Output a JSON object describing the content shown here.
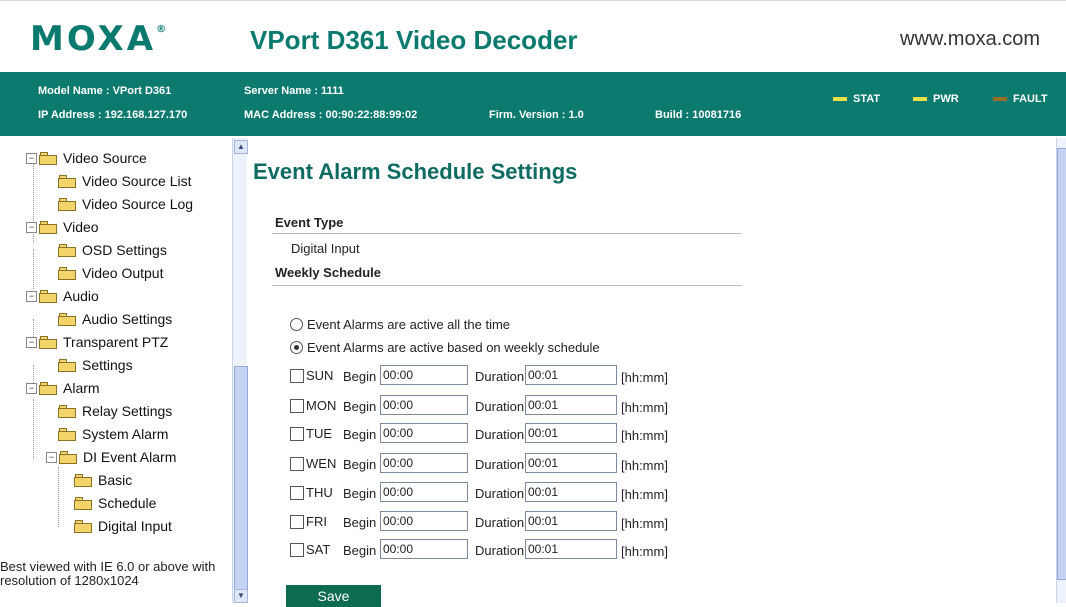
{
  "header": {
    "logo_text": "MOXA",
    "logo_mark": "®",
    "product_title": "VPort D361 Video Decoder",
    "site_url": "www.moxa.com"
  },
  "infobar": {
    "model_name": "Model Name : VPort D361",
    "server_name": "Server Name : 1111",
    "ip_address": "IP Address : 192.168.127.170",
    "mac_address": "MAC Address : 00:90:22:88:99:02",
    "firmware": "Firm. Version : 1.0",
    "build": "Build : 10081716",
    "leds": [
      {
        "label": "STAT",
        "color": "#e8e24a"
      },
      {
        "label": "PWR",
        "color": "#e8e24a"
      },
      {
        "label": "FAULT",
        "color": "#9a6a28"
      }
    ],
    "background": "#0d7a70"
  },
  "sidebar": {
    "items": [
      {
        "label": "Video Source",
        "level": 0,
        "expander": "−"
      },
      {
        "label": "Video Source List",
        "level": 1
      },
      {
        "label": "Video Source Log",
        "level": 1
      },
      {
        "label": "Video",
        "level": 0,
        "expander": "−"
      },
      {
        "label": "OSD Settings",
        "level": 1
      },
      {
        "label": "Video Output",
        "level": 1
      },
      {
        "label": "Audio",
        "level": 0,
        "expander": "−"
      },
      {
        "label": "Audio Settings",
        "level": 1
      },
      {
        "label": "Transparent PTZ",
        "level": 0,
        "expander": "−"
      },
      {
        "label": "Settings",
        "level": 1
      },
      {
        "label": "Alarm",
        "level": 0,
        "expander": "−"
      },
      {
        "label": "Relay Settings",
        "level": 1
      },
      {
        "label": "System Alarm",
        "level": 1
      },
      {
        "label": "DI Event Alarm",
        "level": 1,
        "expander": "−"
      },
      {
        "label": "Basic",
        "level": 2
      },
      {
        "label": "Schedule",
        "level": 2
      },
      {
        "label": "Digital Input",
        "level": 2
      }
    ],
    "best_viewed": "Best viewed with IE 6.0 or above with resolution of 1280x1024"
  },
  "main": {
    "title": "Event Alarm Schedule Settings",
    "event_type_label": "Event Type",
    "event_type_value": "Digital Input",
    "weekly_schedule_label": "Weekly Schedule",
    "radio_always": "Event Alarms are active all the time",
    "radio_weekly": "Event Alarms are active based on weekly schedule",
    "radio_selected": "weekly",
    "begin_label": "Begin",
    "duration_label": "Duration",
    "unit_label": "[hh:mm]",
    "schedule": [
      {
        "day": "SUN",
        "begin": "00:00",
        "duration": "00:01",
        "checked": false
      },
      {
        "day": "MON",
        "begin": "00:00",
        "duration": "00:01",
        "checked": false
      },
      {
        "day": "TUE",
        "begin": "00:00",
        "duration": "00:01",
        "checked": false
      },
      {
        "day": "WEN",
        "begin": "00:00",
        "duration": "00:01",
        "checked": false
      },
      {
        "day": "THU",
        "begin": "00:00",
        "duration": "00:01",
        "checked": false
      },
      {
        "day": "FRI",
        "begin": "00:00",
        "duration": "00:01",
        "checked": false
      },
      {
        "day": "SAT",
        "begin": "00:00",
        "duration": "00:01",
        "checked": false
      }
    ],
    "save_label": "Save"
  },
  "colors": {
    "brand": "#0a7a6e",
    "title": "#0d6b62",
    "save_button": "#0d6b52"
  }
}
